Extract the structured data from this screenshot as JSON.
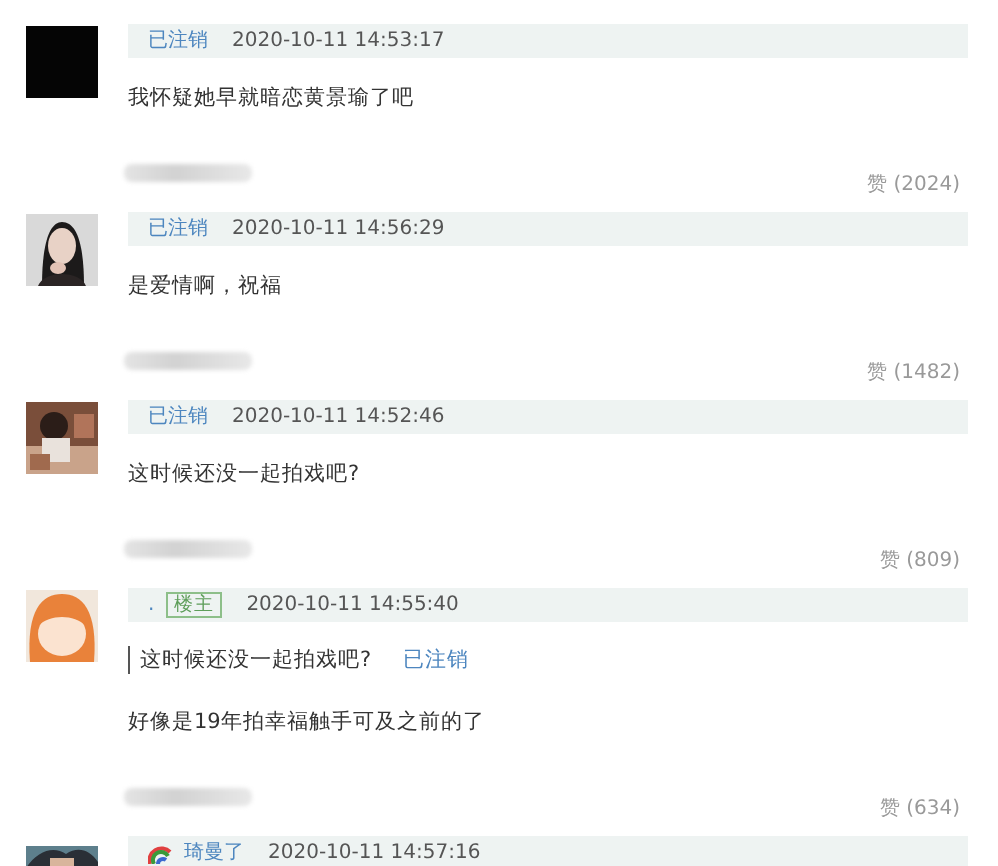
{
  "comments": [
    {
      "user": "已注销",
      "time": "2020-10-11 14:53:17",
      "text": "我怀疑她早就暗恋黄景瑜了吧",
      "likes": "赞 (2024)"
    },
    {
      "user": "已注销",
      "time": "2020-10-11 14:56:29",
      "text": "是爱情啊，祝福",
      "likes": "赞 (1482)"
    },
    {
      "user": "已注销",
      "time": "2020-10-11 14:52:46",
      "text": "这时候还没一起拍戏吧?",
      "likes": "赞 (809)"
    },
    {
      "user": ".",
      "badge": "楼主",
      "time": "2020-10-11 14:55:40",
      "quote": {
        "text": "这时候还没一起拍戏吧?",
        "user": "已注销"
      },
      "text": "好像是19年拍幸福触手可及之前的了",
      "likes": "赞 (634)"
    },
    {
      "user": "琦曼了",
      "emblem": true,
      "time": "2020-10-11 14:57:16"
    }
  ]
}
